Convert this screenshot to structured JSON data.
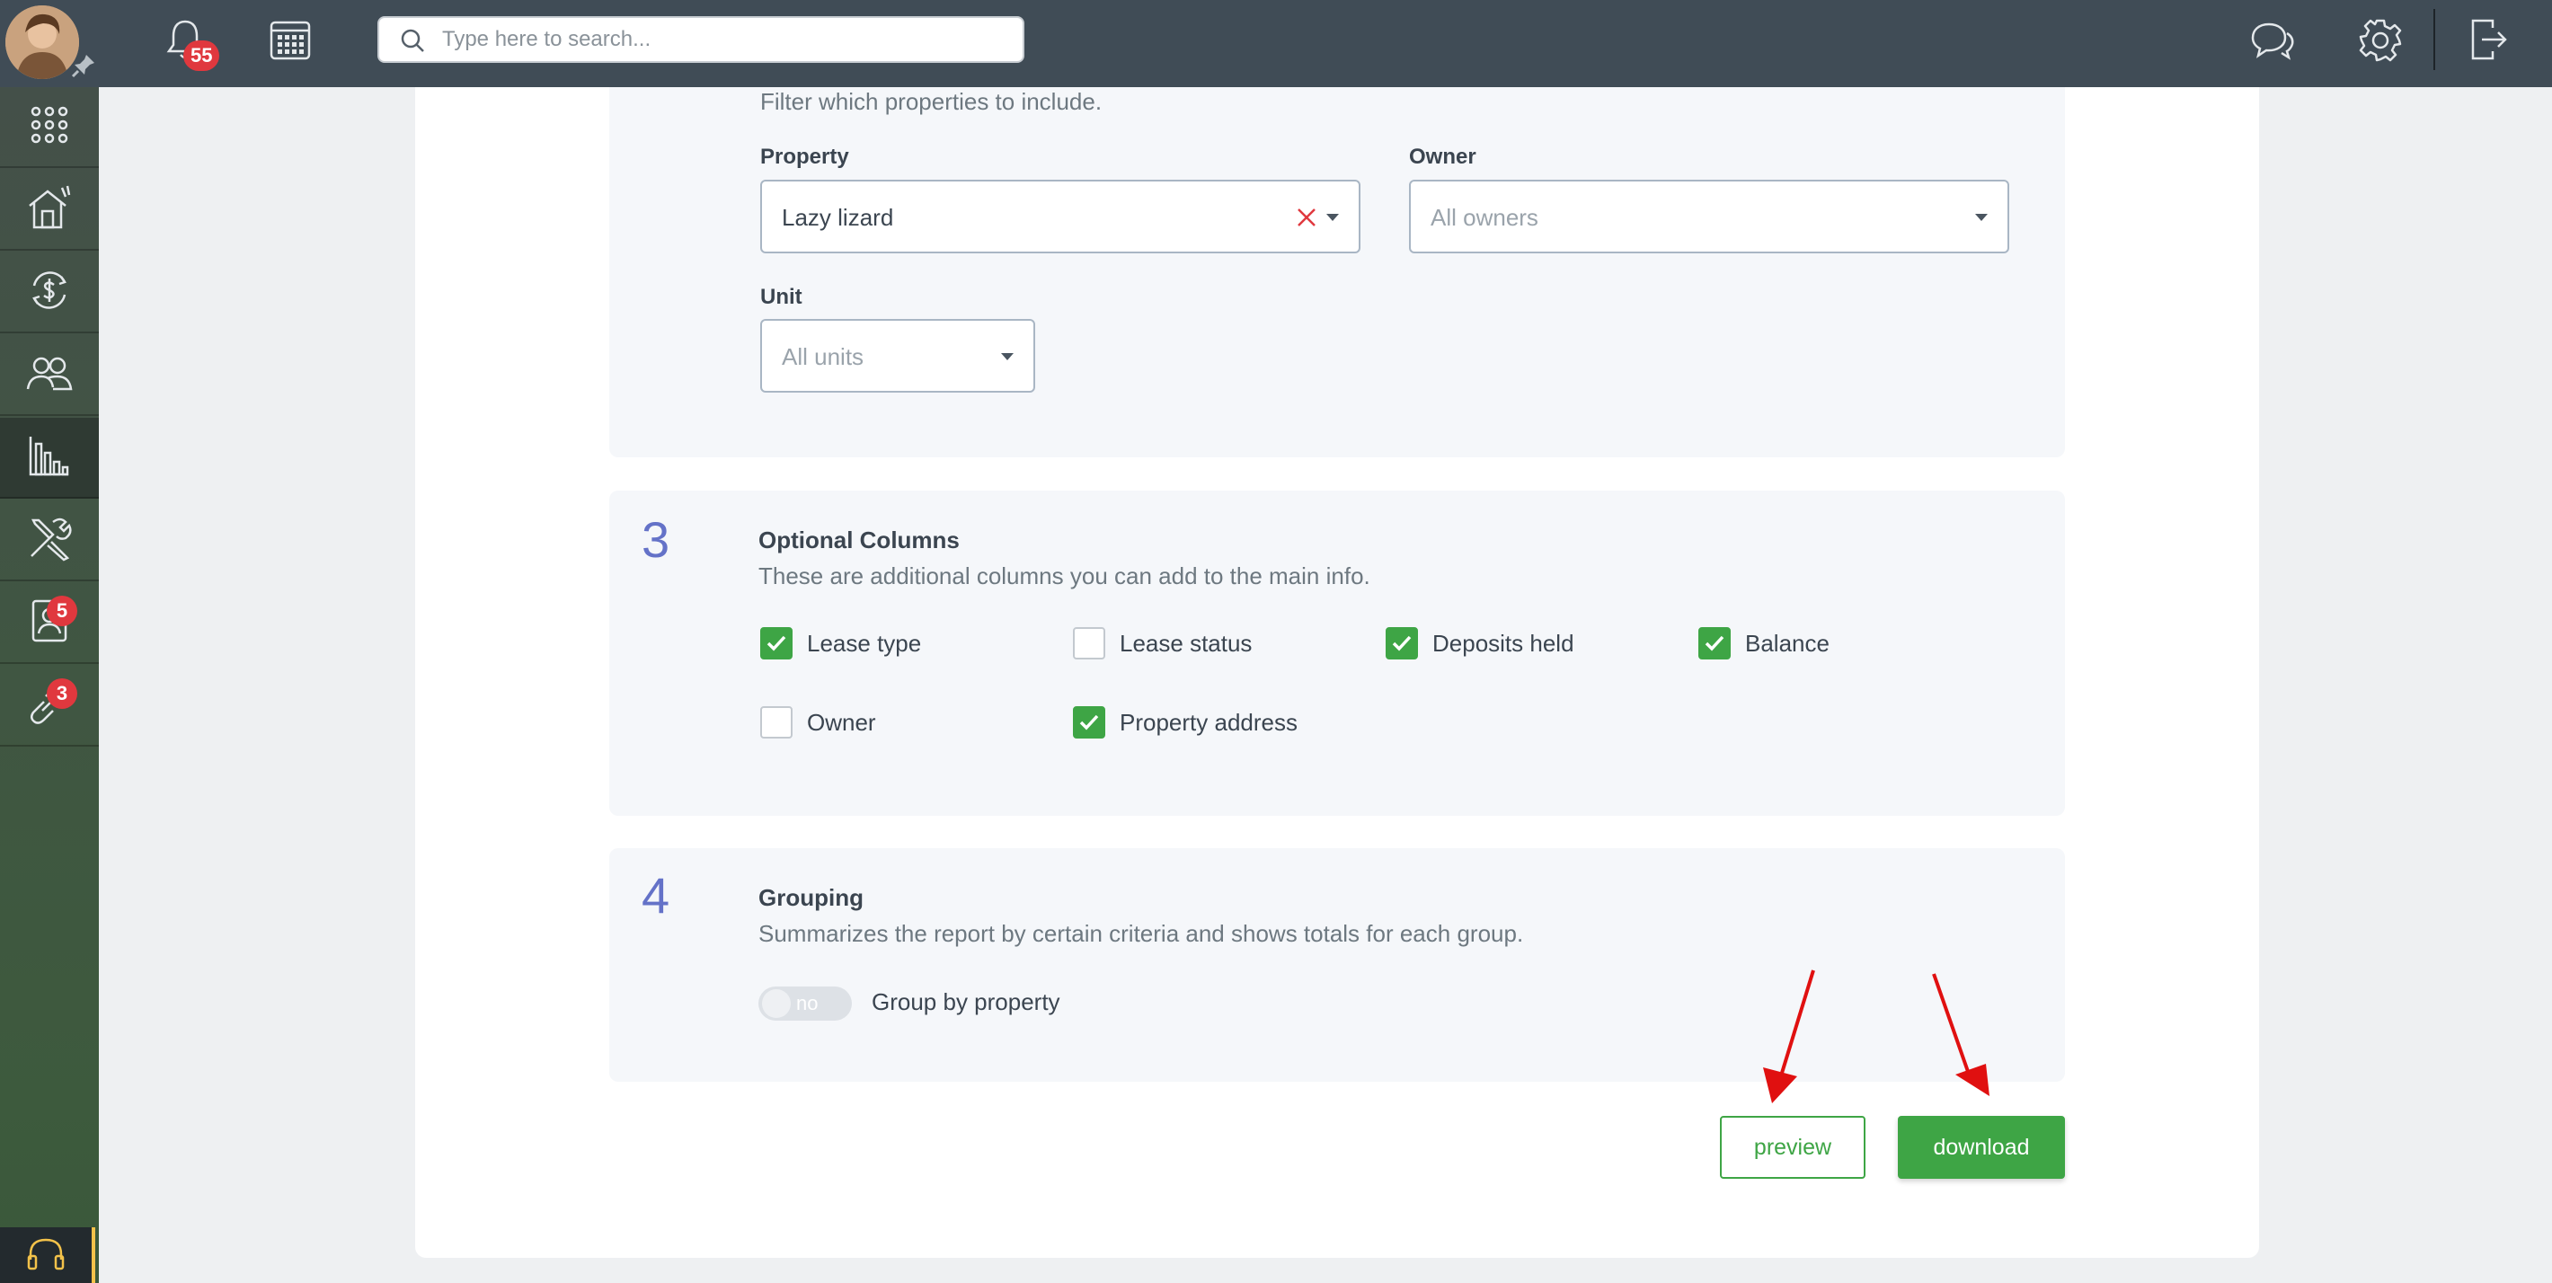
{
  "topbar": {
    "notifications_count": "55",
    "search_placeholder": "Type here to search..."
  },
  "sidebar": {
    "items": [
      {
        "icon": "apps-grid-icon"
      },
      {
        "icon": "properties-house-icon"
      },
      {
        "icon": "accounting-dollar-icon"
      },
      {
        "icon": "people-icon"
      },
      {
        "icon": "reports-chart-icon",
        "active": true
      },
      {
        "icon": "maintenance-tools-icon"
      },
      {
        "icon": "leasing-contact-icon",
        "badge": "5"
      },
      {
        "icon": "integrations-link-icon",
        "badge": "3"
      }
    ]
  },
  "filters": {
    "description": "Filter which properties to include.",
    "property_label": "Property",
    "property_value": "Lazy lizard",
    "owner_label": "Owner",
    "owner_placeholder": "All owners",
    "unit_label": "Unit",
    "unit_placeholder": "All units"
  },
  "optional_columns": {
    "number": "3",
    "title": "Optional Columns",
    "description": "These are additional columns you can add to the main info.",
    "options": [
      {
        "label": "Lease type",
        "checked": true
      },
      {
        "label": "Lease status",
        "checked": false
      },
      {
        "label": "Deposits held",
        "checked": true
      },
      {
        "label": "Balance",
        "checked": true
      },
      {
        "label": "Owner",
        "checked": false
      },
      {
        "label": "Property address",
        "checked": true
      }
    ]
  },
  "grouping": {
    "number": "4",
    "title": "Grouping",
    "description": "Summarizes the report by certain criteria and shows totals for each group.",
    "toggle_text": "no",
    "toggle_label": "Group by property"
  },
  "actions": {
    "preview_label": "preview",
    "download_label": "download"
  },
  "colors": {
    "accent_green": "#3ea545",
    "topbar": "#404c56",
    "section_number": "#6472c8",
    "badge_red": "#e0383e",
    "arrow_red": "#e01010"
  }
}
